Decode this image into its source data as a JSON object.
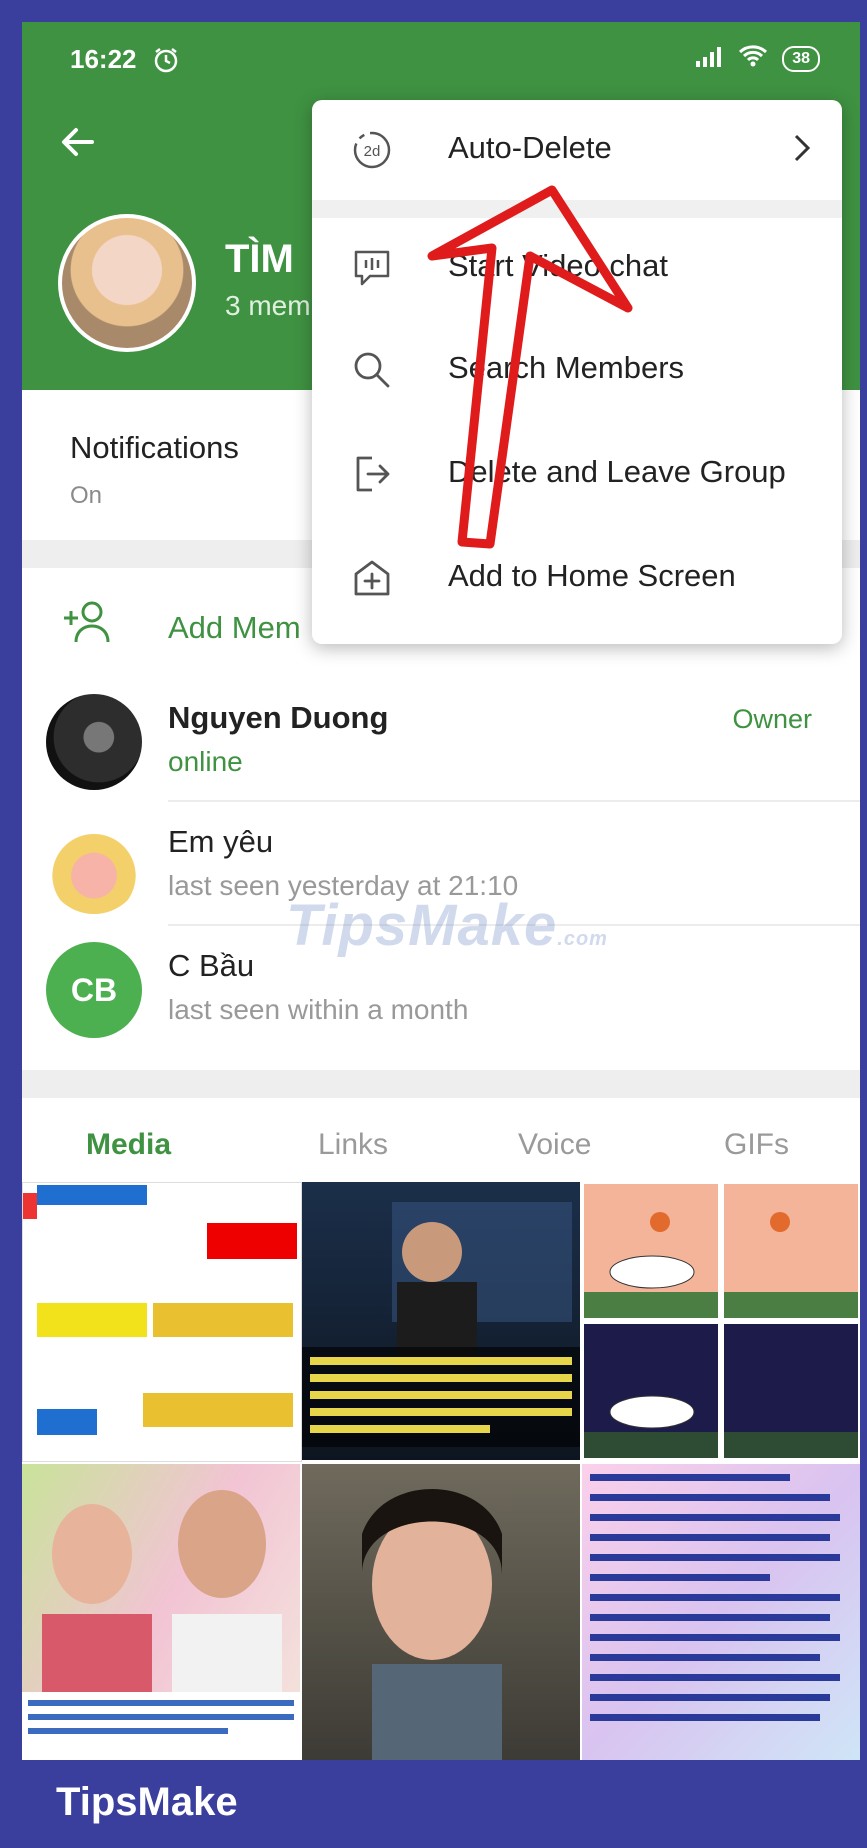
{
  "status_bar": {
    "time": "16:22",
    "battery": "38"
  },
  "header": {
    "title": "TÌM",
    "subtitle": "3 mem"
  },
  "notifications": {
    "label": "Notifications",
    "value": "On"
  },
  "add_members": {
    "label": "Add Mem"
  },
  "members": [
    {
      "name": "Nguyen Duong",
      "status": "online",
      "role": "Owner"
    },
    {
      "name": "Em yêu",
      "status": "last seen yesterday at 21:10",
      "role": ""
    },
    {
      "name": "C Bầu",
      "status": "last seen within a month",
      "role": "",
      "initials": "CB"
    }
  ],
  "tabs": [
    {
      "label": "Media",
      "active": true
    },
    {
      "label": "Links",
      "active": false
    },
    {
      "label": "Voice",
      "active": false
    },
    {
      "label": "GIFs",
      "active": false
    }
  ],
  "menu": {
    "items": [
      {
        "label": "Auto-Delete",
        "icon": "timer-2d-icon"
      },
      {
        "label": "Start Video chat",
        "icon": "video-chat-icon"
      },
      {
        "label": "Search Members",
        "icon": "search-icon"
      },
      {
        "label": "Delete and Leave Group",
        "icon": "leave-icon"
      },
      {
        "label": "Add to Home Screen",
        "icon": "add-home-icon"
      }
    ],
    "timer_badge": "2d"
  },
  "watermark": {
    "text": "TipsMake",
    "suffix": ".com"
  },
  "footer": {
    "brand": "TipsMake"
  },
  "colors": {
    "accent": "#3f9242",
    "frame": "#3a3f9e",
    "annotation": "#e01b1b"
  }
}
